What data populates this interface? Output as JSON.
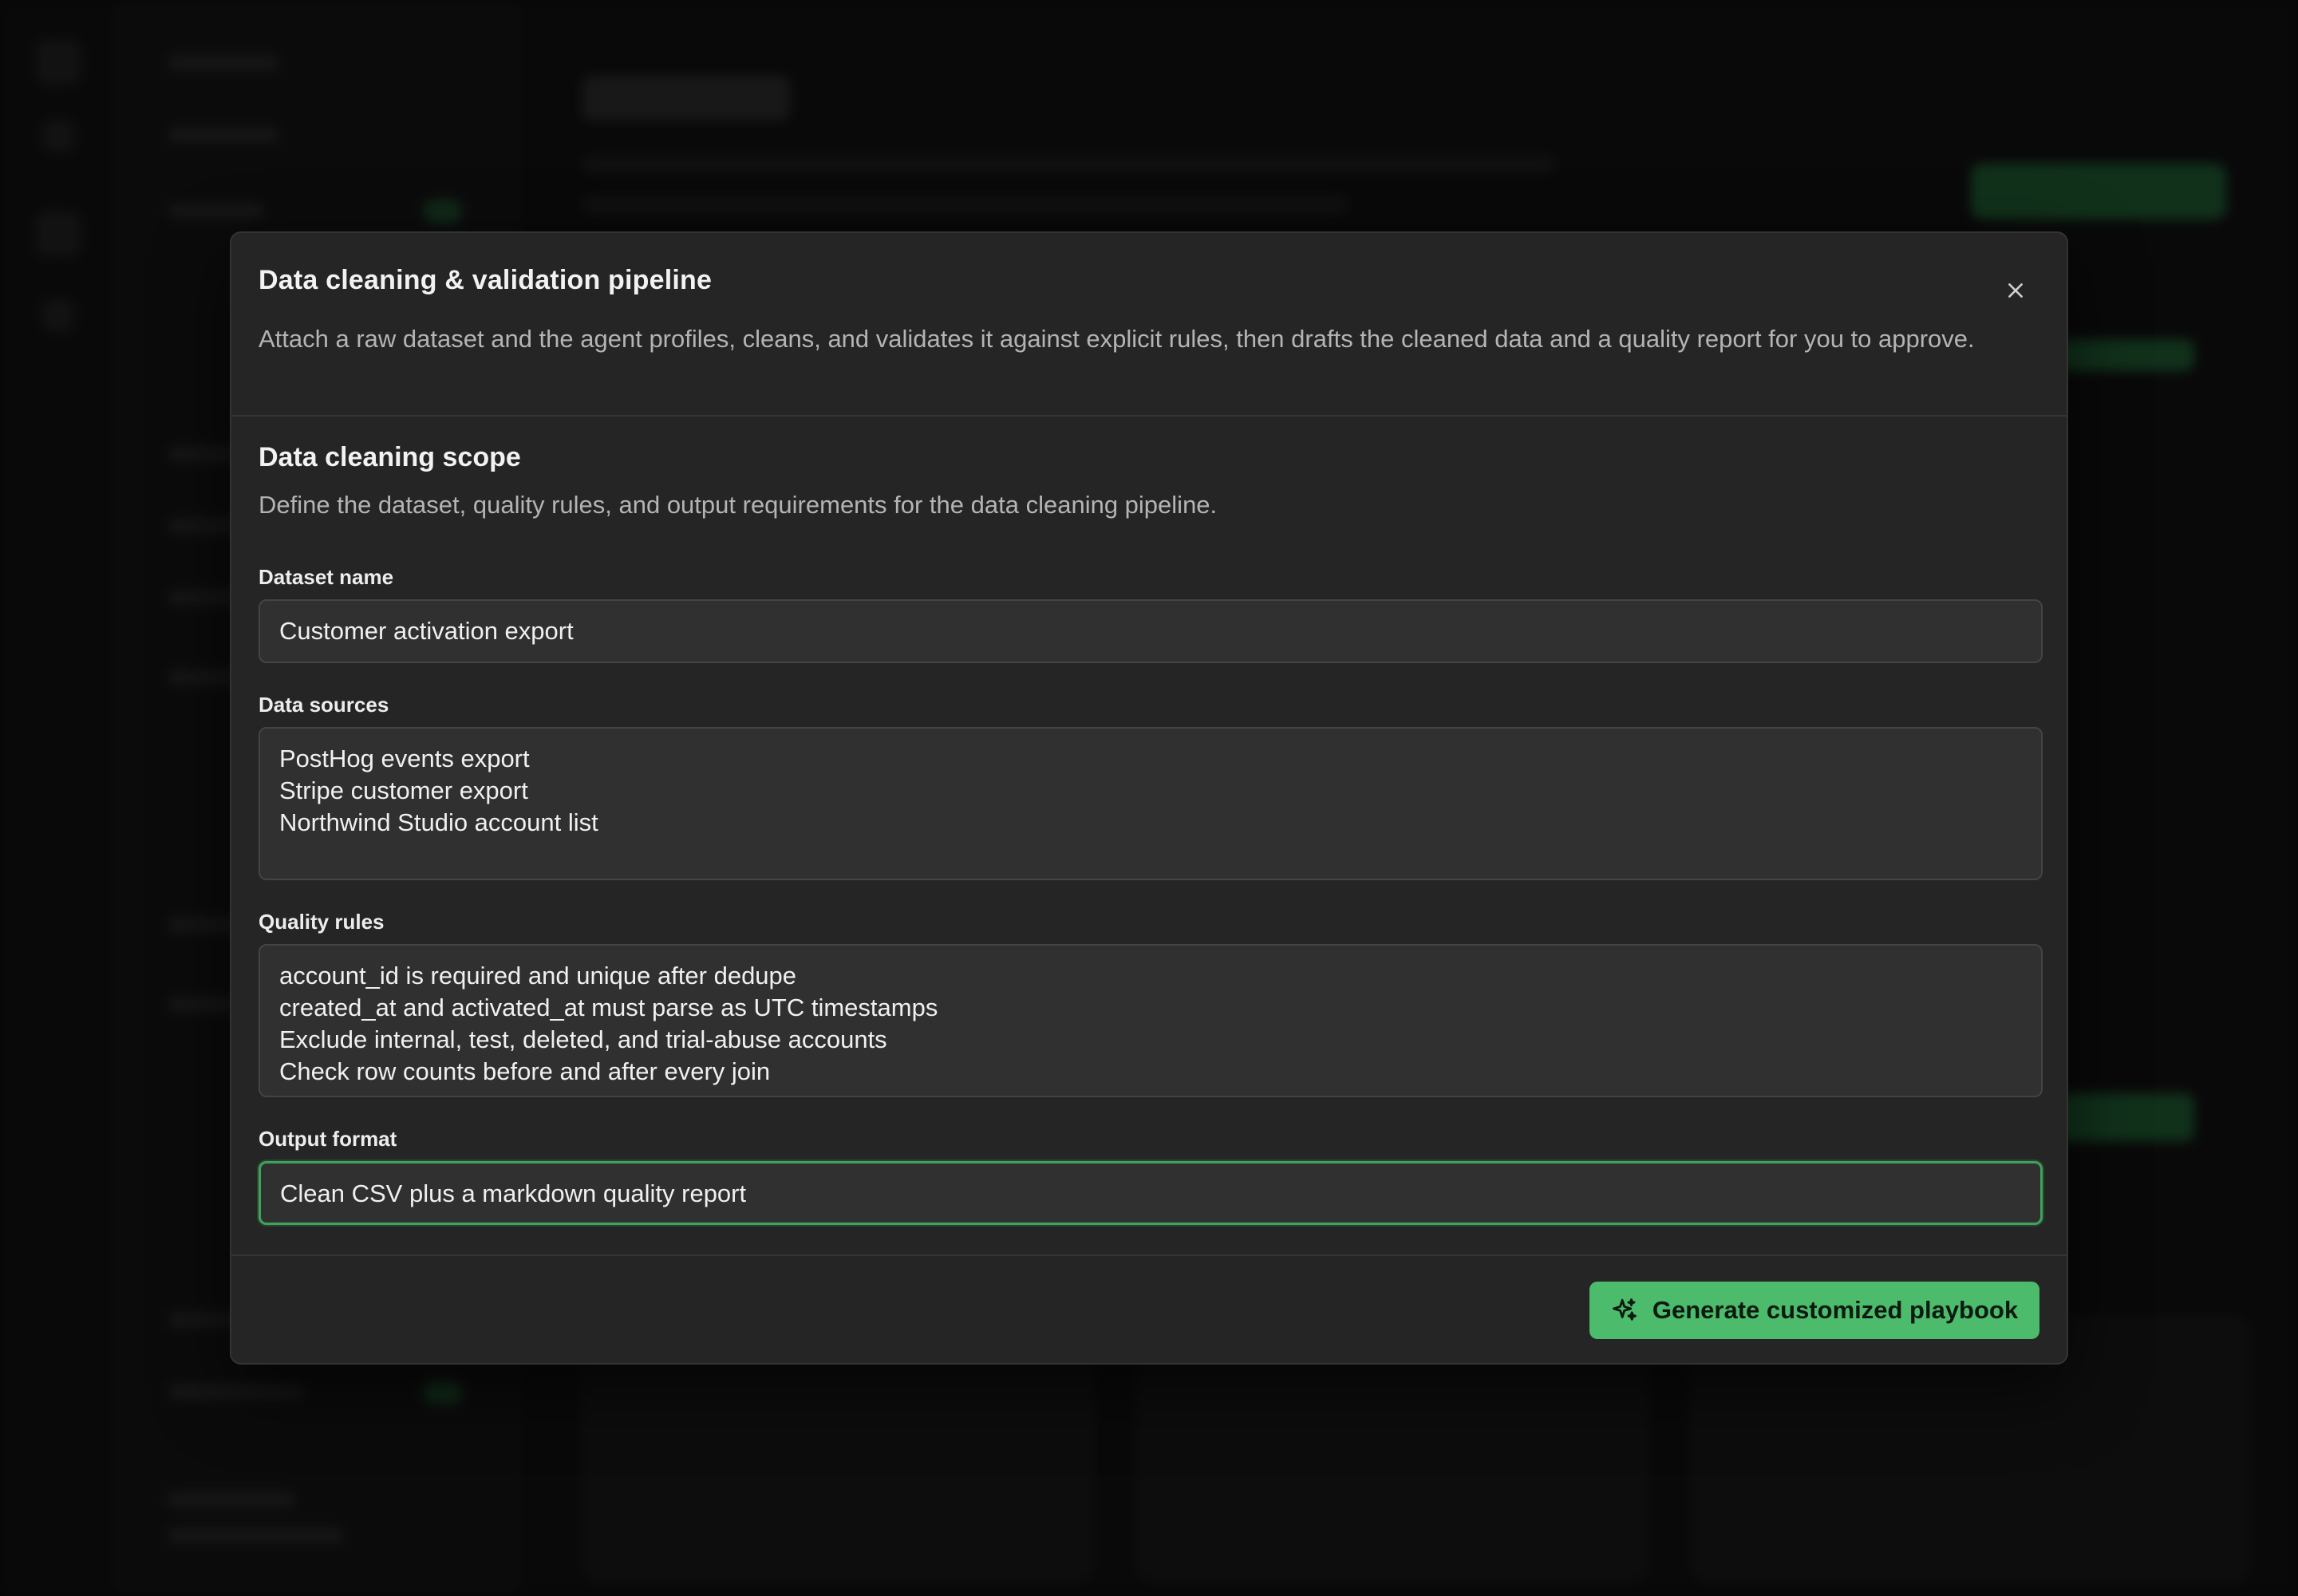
{
  "modal": {
    "title": "Data cleaning & validation pipeline",
    "description": "Attach a raw dataset and the agent profiles, cleans, and validates it against explicit rules, then drafts the cleaned data and a quality report for you to approve.",
    "close_icon": "close-icon"
  },
  "section": {
    "title": "Data cleaning scope",
    "description": "Define the dataset, quality rules, and output requirements for the data cleaning pipeline."
  },
  "fields": {
    "dataset_name": {
      "label": "Dataset name",
      "value": "Customer activation export"
    },
    "data_sources": {
      "label": "Data sources",
      "value": "PostHog events export\nStripe customer export\nNorthwind Studio account list"
    },
    "quality_rules": {
      "label": "Quality rules",
      "value": "account_id is required and unique after dedupe\ncreated_at and activated_at must parse as UTC timestamps\nExclude internal, test, deleted, and trial-abuse accounts\nCheck row counts before and after every join"
    },
    "output_format": {
      "label": "Output format",
      "value": "Clean CSV plus a markdown quality report"
    }
  },
  "footer": {
    "generate_label": "Generate customized playbook",
    "generate_icon": "sparkles-icon"
  },
  "colors": {
    "accent": "#4cbb6b",
    "focus_border": "#3fa35b",
    "modal_bg": "#252525",
    "field_bg": "#303030"
  }
}
